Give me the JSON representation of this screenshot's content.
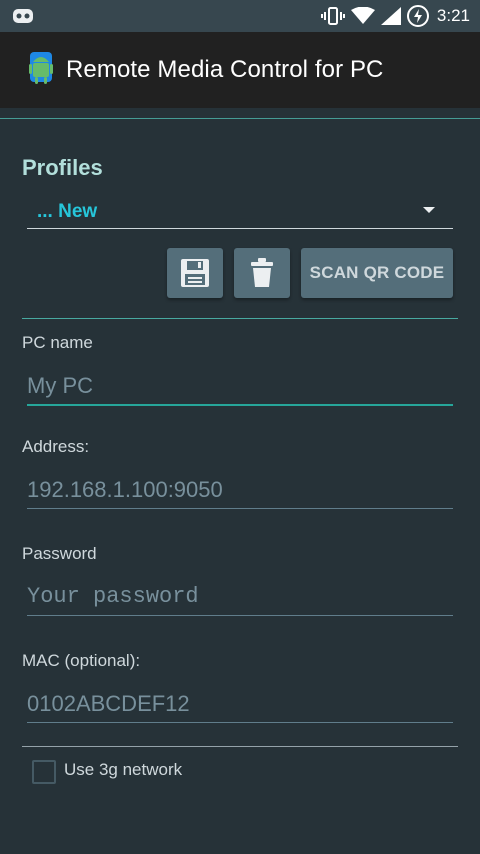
{
  "status_bar": {
    "time": "3:21",
    "icons": [
      "cyanogen-icon",
      "vibrate-icon",
      "wifi-icon",
      "signal-icon",
      "battery-charging-icon"
    ]
  },
  "app_bar": {
    "title": "Remote Media Control for PC",
    "logo": "android-logo"
  },
  "profiles": {
    "title": "Profiles",
    "selected": "... New",
    "buttons": {
      "save_icon": "save-icon",
      "delete_icon": "trash-icon",
      "scan_label": "SCAN QR CODE"
    }
  },
  "form": {
    "pc_name": {
      "label": "PC name",
      "placeholder": "My PC"
    },
    "address": {
      "label": "Address:",
      "placeholder": "192.168.1.100:9050"
    },
    "password": {
      "label": "Password",
      "placeholder": "Your password"
    },
    "mac": {
      "label": "MAC (optional):",
      "placeholder": "0102ABCDEF12"
    },
    "use_3g": {
      "label": "Use 3g network",
      "checked": false
    }
  },
  "colors": {
    "background": "#263238",
    "accent": "#26c6da",
    "status_bar": "#37474f",
    "app_bar": "#212121"
  }
}
